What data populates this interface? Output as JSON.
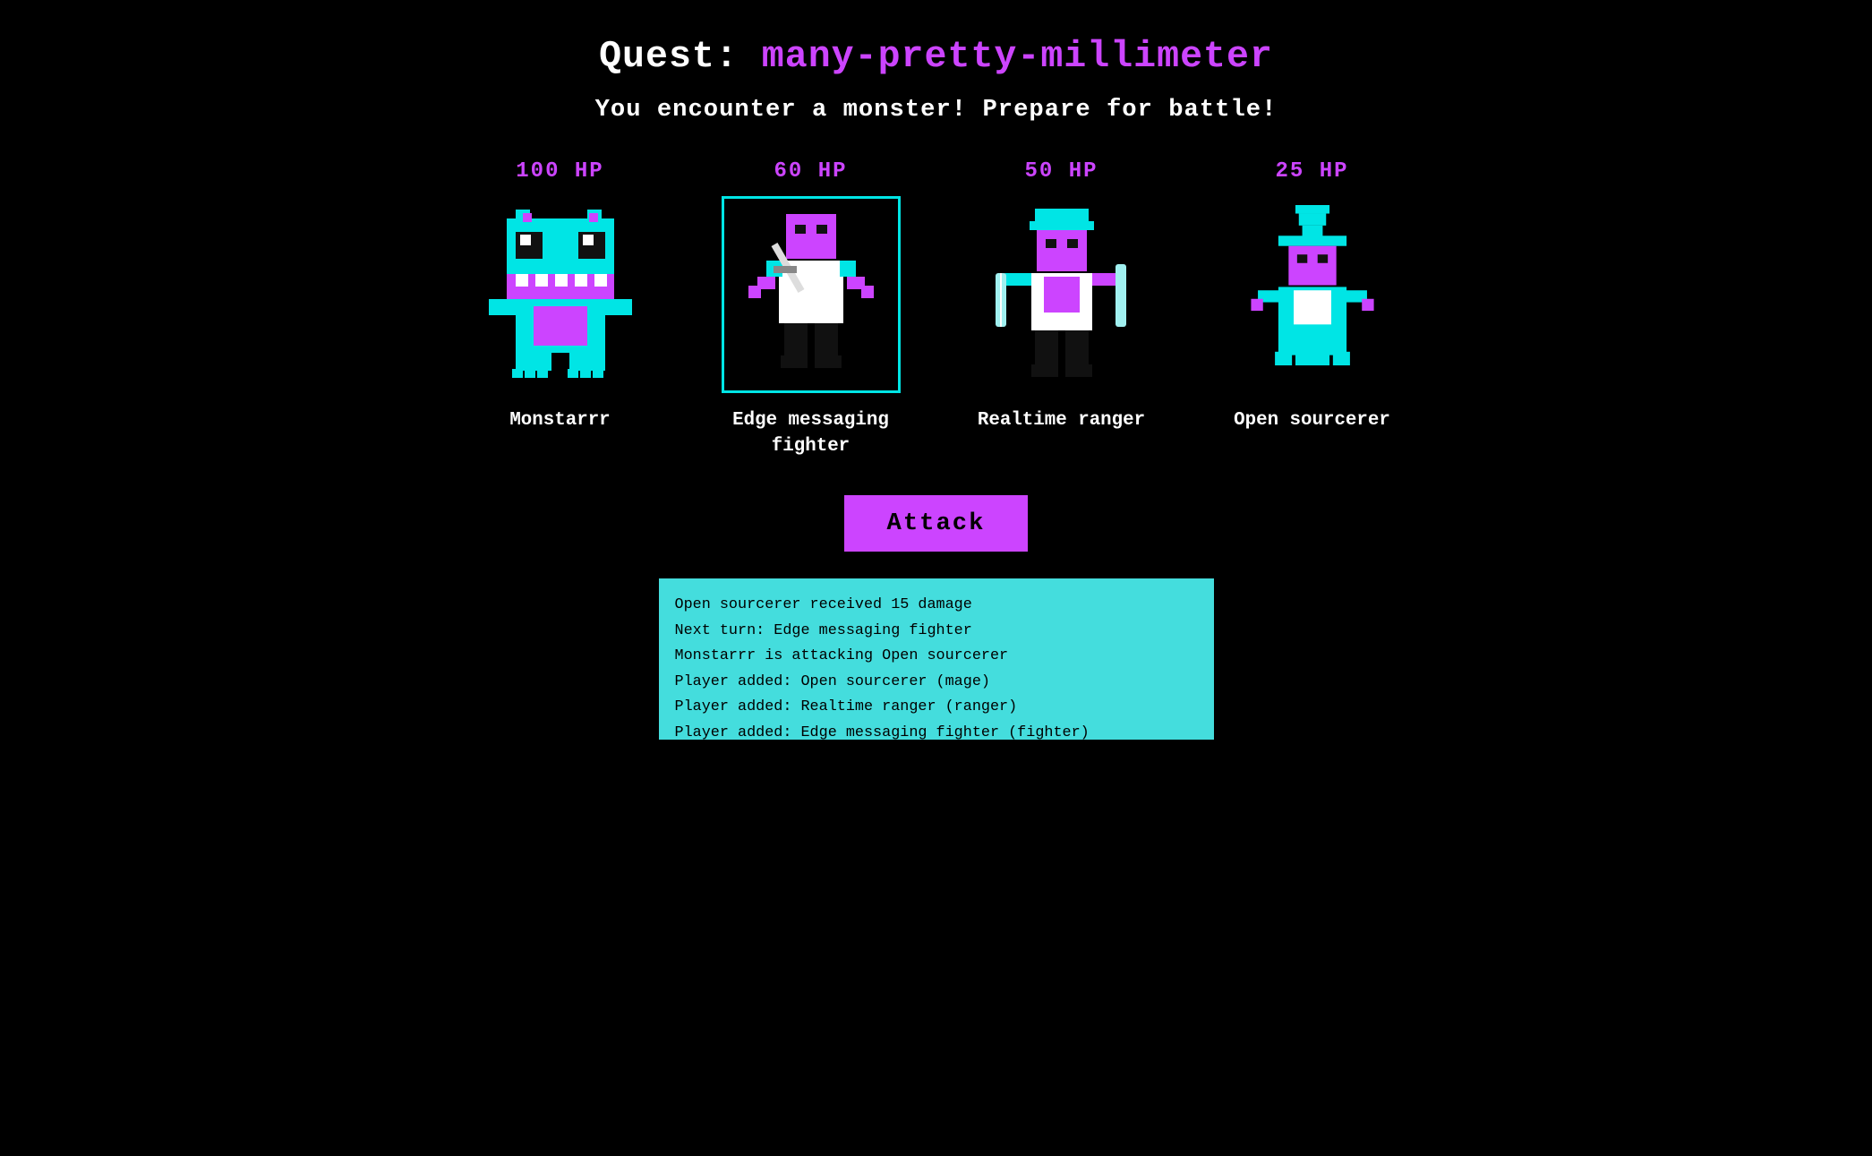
{
  "page": {
    "quest_label": "Quest:",
    "quest_name": "many-pretty-millimeter",
    "encounter_text": "You encounter a monster!  Prepare for battle!"
  },
  "characters": [
    {
      "id": "monstarrr",
      "hp": "100 HP",
      "name": "Monstarrr",
      "selected": false,
      "sprite_type": "monster"
    },
    {
      "id": "edge-messaging-fighter",
      "hp": "60 HP",
      "name": "Edge messaging\nfighter",
      "selected": true,
      "sprite_type": "fighter"
    },
    {
      "id": "realtime-ranger",
      "hp": "50 HP",
      "name": "Realtime ranger",
      "selected": false,
      "sprite_type": "ranger"
    },
    {
      "id": "open-sourcerer",
      "hp": "25 HP",
      "name": "Open sourcerer",
      "selected": false,
      "sprite_type": "sourcerer"
    }
  ],
  "attack_button": {
    "label": "Attack"
  },
  "battle_log": {
    "lines": [
      "Open sourcerer received 15 damage",
      "Next turn: Edge messaging fighter",
      "Monstarrr is attacking Open sourcerer",
      "Player added: Open sourcerer (mage)",
      "Player added: Realtime ranger (ranger)",
      "Player added: Edge messaging fighter (fighter)"
    ]
  }
}
